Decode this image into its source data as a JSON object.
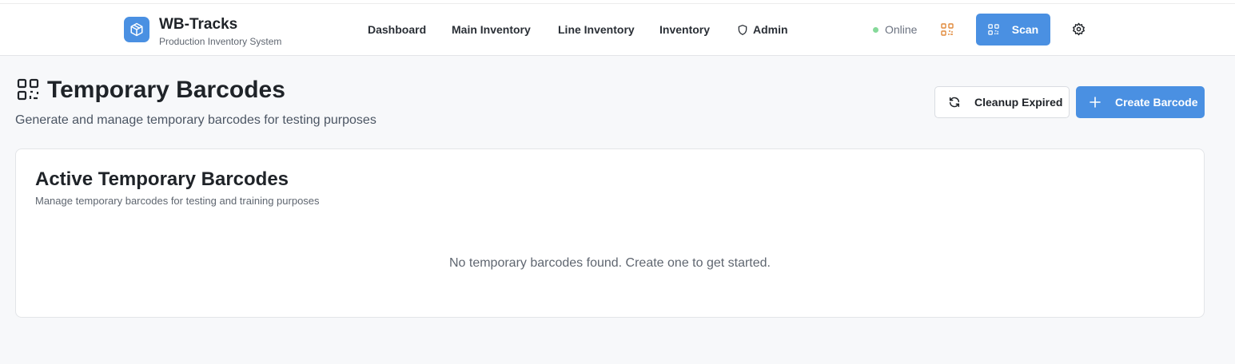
{
  "brand": {
    "title": "WB-Tracks",
    "subtitle": "Production Inventory System",
    "logo_icon": "package-icon",
    "accent_color": "#4a90e2"
  },
  "nav": {
    "items": [
      {
        "label": "Dashboard"
      },
      {
        "label": "Main Inventory"
      },
      {
        "label": "Line Inventory"
      },
      {
        "label": "Inventory"
      },
      {
        "label": "Admin",
        "icon": "shield-icon"
      }
    ]
  },
  "header_actions": {
    "status_label": "Online",
    "status_color": "#86d99a",
    "qr_icon_color": "#e08a3c",
    "scan_label": "Scan",
    "settings_icon": "gear-icon"
  },
  "page": {
    "title": "Temporary Barcodes",
    "subtitle": "Generate and manage temporary barcodes for testing purposes",
    "title_icon": "qr-code-icon"
  },
  "actions": {
    "cleanup_label": "Cleanup Expired",
    "create_label": "Create Barcode"
  },
  "card": {
    "title": "Active Temporary Barcodes",
    "subtitle": "Manage temporary barcodes for testing and training purposes",
    "empty_message": "No temporary barcodes found. Create one to get started."
  }
}
